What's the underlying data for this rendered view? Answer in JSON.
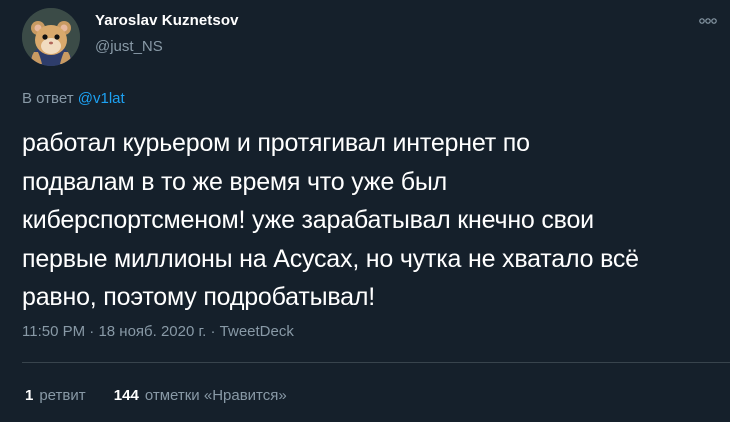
{
  "author": {
    "name": "Yaroslav Kuznetsov",
    "handle": "@just_NS",
    "avatar_icon": "hamster-avatar-icon"
  },
  "menu": {
    "icon": "more-options-icon"
  },
  "reply": {
    "prefix": "В ответ",
    "to": "@v1lat"
  },
  "tweet": {
    "lines": [
      "работал курьером и протягивал интернет по",
      "подвалам в то же время что уже был",
      "киберспортсменом! уже зарабатывал кнечно свои",
      "первые миллионы на Асусах, но чутка не хватало всё",
      "равно, поэтому подробатывал!"
    ]
  },
  "meta": {
    "time": "11:50 PM",
    "separator1": " · ",
    "date": "18 нояб. 2020 г.",
    "separator2": " · ",
    "source": "TweetDeck"
  },
  "stats": {
    "retweets_count": "1",
    "retweets_label": "ретвит",
    "likes_count": "144",
    "likes_label": "отметки «Нравится»"
  },
  "colors": {
    "background": "#15202b",
    "text_primary": "#ffffff",
    "text_secondary": "#8899a6",
    "link": "#1da1f2",
    "divider": "#38444d"
  }
}
